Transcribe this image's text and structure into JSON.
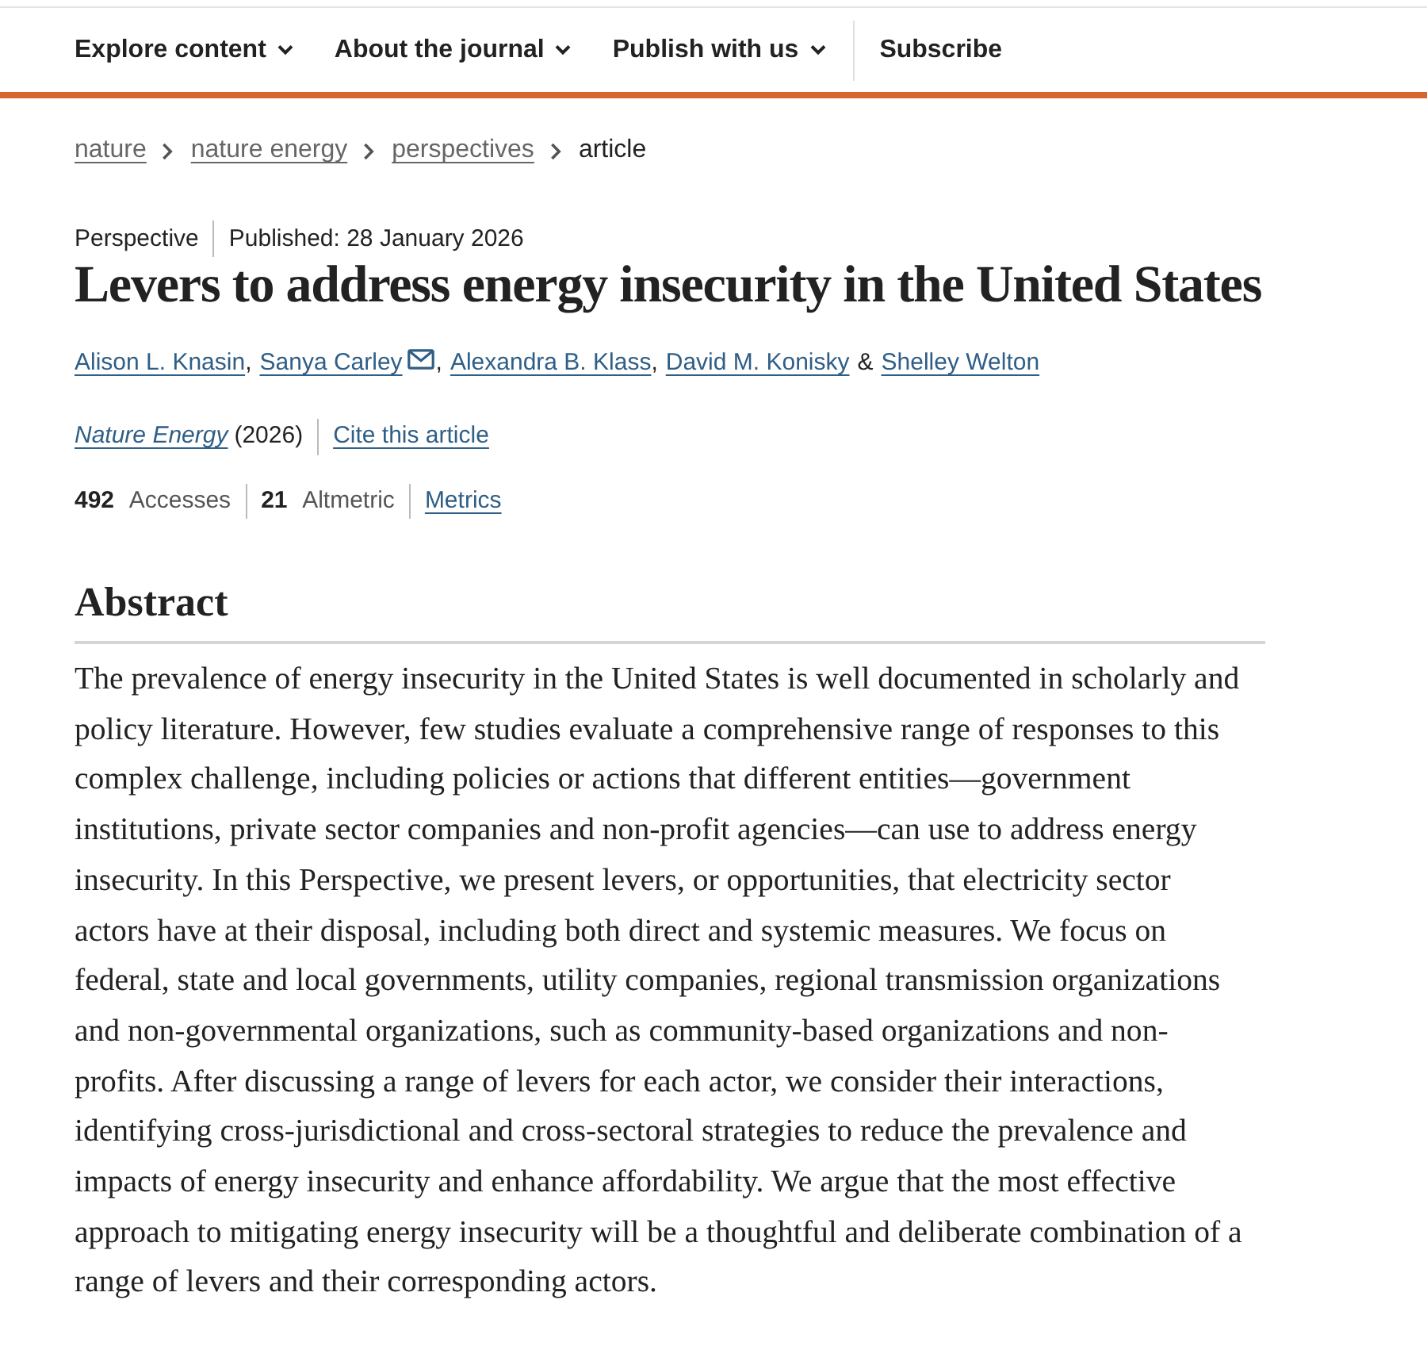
{
  "nav": {
    "items": [
      {
        "label": "Explore content",
        "kind": "menu"
      },
      {
        "label": "About the journal",
        "kind": "menu"
      },
      {
        "label": "Publish with us",
        "kind": "menu"
      },
      {
        "label": "Subscribe",
        "kind": "link"
      }
    ]
  },
  "breadcrumb": [
    {
      "label": "nature",
      "kind": "link"
    },
    {
      "label": "nature energy",
      "kind": "link"
    },
    {
      "label": "perspectives",
      "kind": "link"
    },
    {
      "label": "article",
      "kind": "current"
    }
  ],
  "article": {
    "type": "Perspective",
    "published": "Published: 28 January 2026",
    "title": "Levers to address energy insecurity in the United States",
    "authors": [
      {
        "name": "Alison L. Knasin",
        "email": false,
        "separator": ","
      },
      {
        "name": "Sanya Carley",
        "email": true,
        "separator": ","
      },
      {
        "name": "Alexandra B. Klass",
        "email": false,
        "separator": ","
      },
      {
        "name": "David M. Konisky",
        "email": false,
        "separator": "&"
      },
      {
        "name": "Shelley Welton",
        "email": false
      }
    ],
    "citation": {
      "journal": "Nature Energy",
      "year": "(2026)",
      "cite_link": "Cite this article"
    },
    "metrics": {
      "items": [
        "**492** Accesses",
        "**21** Altmetric"
      ],
      "link": "Metrics"
    }
  },
  "abstract": {
    "heading": "Abstract",
    "text": "The prevalence of energy insecurity in the United States is well documented in scholarly and policy literature. However, few studies evaluate a comprehensive range of responses to this complex challenge, including policies or actions that different entities—government institutions, private sector companies and non-profit agencies—can use to address energy insecurity. In this Perspective, we present levers, or opportunities, that electricity sector actors have at their disposal, including both direct and systemic measures. We focus on federal, state and local governments, utility companies, regional transmission organizations and non-governmental organizations, such as community-based organizations and non-profits. After discussing a range of levers for each actor, we consider their interactions, identifying cross-jurisdictional and cross-sectoral strategies to reduce the prevalence and impacts of energy insecurity and enhance affordability. We argue that the most effective approach to mitigating energy insecurity will be a thoughtful and deliberate combination of a range of levers and their corresponding actors."
  }
}
